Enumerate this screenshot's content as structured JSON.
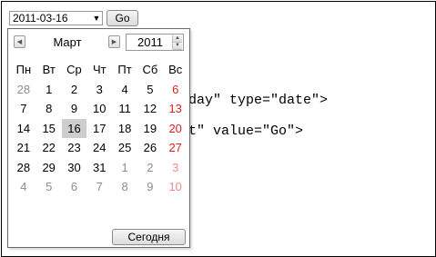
{
  "form": {
    "date_value": "2011-03-16",
    "go_label": "Go"
  },
  "code_lines": [
    "irthday\" type=\"date\">",
    "ubmit\" value=\"Go\">"
  ],
  "calendar": {
    "month": "Март",
    "year": "2011",
    "weekdays": [
      "Пн",
      "Вт",
      "Ср",
      "Чт",
      "Пт",
      "Сб",
      "Вс"
    ],
    "weeks": [
      [
        {
          "d": "28",
          "other": true
        },
        {
          "d": "1"
        },
        {
          "d": "2"
        },
        {
          "d": "3"
        },
        {
          "d": "4"
        },
        {
          "d": "5"
        },
        {
          "d": "6"
        }
      ],
      [
        {
          "d": "7"
        },
        {
          "d": "8"
        },
        {
          "d": "9"
        },
        {
          "d": "10"
        },
        {
          "d": "11"
        },
        {
          "d": "12"
        },
        {
          "d": "13"
        }
      ],
      [
        {
          "d": "14"
        },
        {
          "d": "15"
        },
        {
          "d": "16",
          "selected": true
        },
        {
          "d": "17"
        },
        {
          "d": "18"
        },
        {
          "d": "19"
        },
        {
          "d": "20"
        }
      ],
      [
        {
          "d": "21"
        },
        {
          "d": "22"
        },
        {
          "d": "23"
        },
        {
          "d": "24"
        },
        {
          "d": "25"
        },
        {
          "d": "26"
        },
        {
          "d": "27"
        }
      ],
      [
        {
          "d": "28"
        },
        {
          "d": "29"
        },
        {
          "d": "30"
        },
        {
          "d": "31"
        },
        {
          "d": "1",
          "other": true
        },
        {
          "d": "2",
          "other": true
        },
        {
          "d": "3",
          "other": true
        }
      ],
      [
        {
          "d": "4",
          "other": true
        },
        {
          "d": "5",
          "other": true
        },
        {
          "d": "6",
          "other": true
        },
        {
          "d": "7",
          "other": true
        },
        {
          "d": "8",
          "other": true
        },
        {
          "d": "9",
          "other": true
        },
        {
          "d": "10",
          "other": true
        }
      ]
    ],
    "today_label": "Сегодня",
    "weekend_color": "#e02020",
    "selected_color": "#cdcdcd"
  },
  "icons": {
    "prev": "triangle-left-icon",
    "next": "triangle-right-icon",
    "dropdown": "dropdown-arrow-icon"
  }
}
